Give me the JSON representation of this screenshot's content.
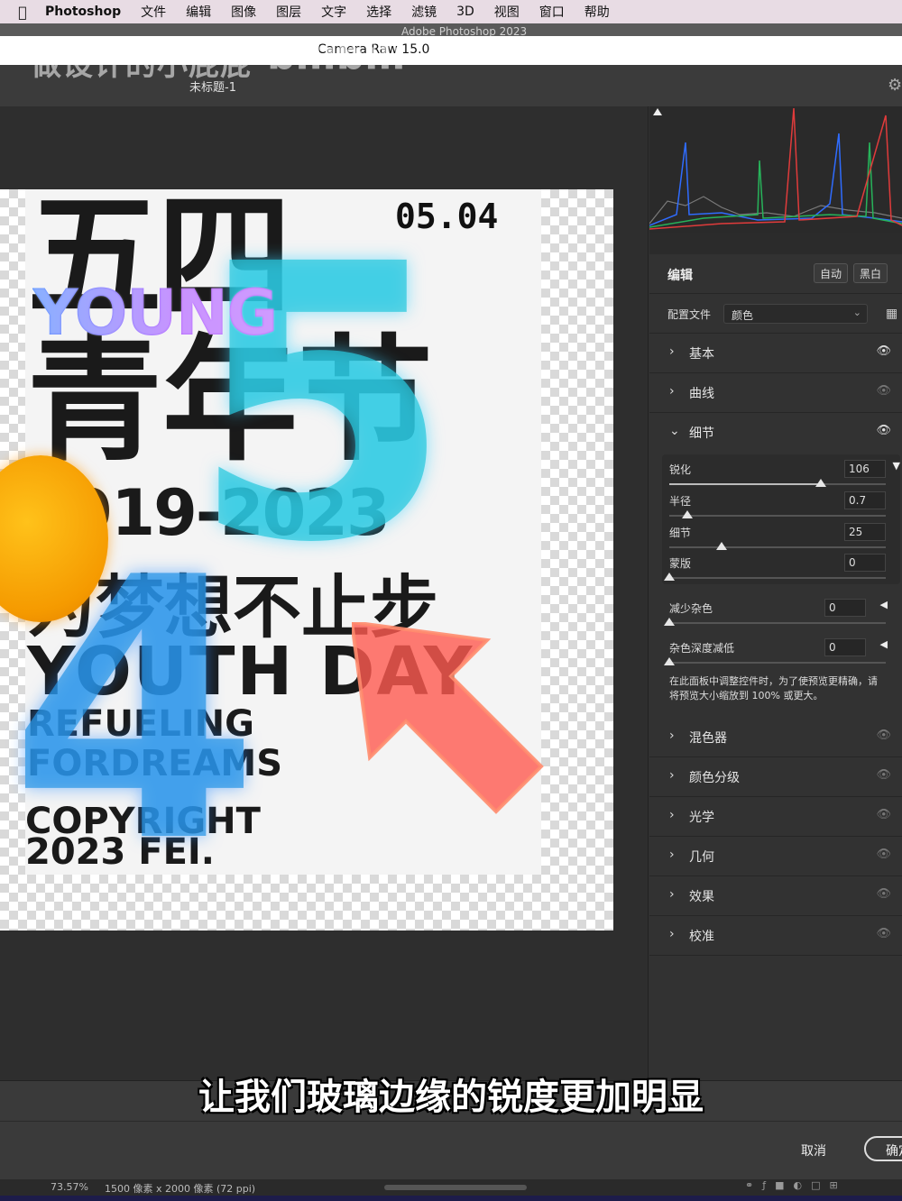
{
  "menubar": {
    "apple_icon": "apple-icon",
    "app_name": "Photoshop",
    "items": [
      "文件",
      "编辑",
      "图像",
      "图层",
      "文字",
      "选择",
      "滤镜",
      "3D",
      "视图",
      "窗口",
      "帮助"
    ]
  },
  "window": {
    "ps_title": "Adobe Photoshop 2023",
    "dialog_title": "Camera Raw 15.0",
    "document_name": "未标题-1",
    "watermark_left": "做设计的小屁屁",
    "watermark_right": "bilibili"
  },
  "poster": {
    "date": "05.04",
    "big_line1": "五四",
    "big_line2": "青年节",
    "young": "YOUNG",
    "years": "1919-2023",
    "slogan": "为梦想不止步",
    "youth": "YOUTH DAY",
    "small1": "REFUELING",
    "small2": "FORDREAMS",
    "copy": "COPYRIGHT",
    "year2": "2023 FEI.",
    "digit5": "5",
    "digit4": "4"
  },
  "panel": {
    "edit_label": "编辑",
    "auto_button": "自动",
    "bw_button": "黑白",
    "profile_label": "配置文件",
    "profile_value": "颜色",
    "sections_top": [
      {
        "label": "基本",
        "expanded": false,
        "visible": true
      },
      {
        "label": "曲线",
        "expanded": false,
        "visible": false
      },
      {
        "label": "细节",
        "expanded": true,
        "visible": true
      }
    ],
    "detail": {
      "sharpen_label": "锐化",
      "sharpen_value": "106",
      "radius_label": "半径",
      "radius_value": "0.7",
      "detail_label": "细节",
      "detail_value": "25",
      "mask_label": "蒙版",
      "mask_value": "0",
      "noise_label": "减少杂色",
      "noise_value": "0",
      "color_noise_label": "杂色深度减低",
      "color_noise_value": "0",
      "note": "在此面板中调整控件时，为了使预览更精确，请将预览大小缩放到 100% 或更大。"
    },
    "sections_bottom": [
      {
        "label": "混色器"
      },
      {
        "label": "颜色分级"
      },
      {
        "label": "光学"
      },
      {
        "label": "几何"
      },
      {
        "label": "效果"
      },
      {
        "label": "校准"
      }
    ]
  },
  "footer": {
    "subtitle": "让我们玻璃边缘的锐度更加明显",
    "cancel": "取消",
    "ok": "确定",
    "zoom": "73.57%",
    "doc_info": "1500 像素 x 2000 像素 (72 ppi)"
  },
  "colors": {
    "panel_bg": "#323232",
    "menubar_bg": "#e8dce4"
  }
}
